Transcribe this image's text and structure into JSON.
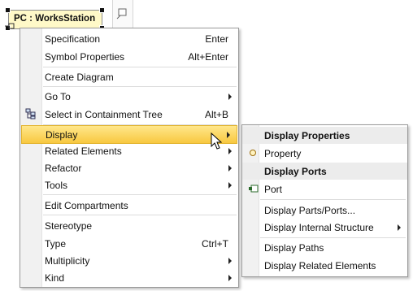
{
  "diagram": {
    "element_label": "PC : WorksStation"
  },
  "context_menu": {
    "items": [
      {
        "label": "Specification",
        "accel": "Enter"
      },
      {
        "label": "Symbol Properties",
        "accel": "Alt+Enter"
      },
      {
        "label": "Create Diagram"
      },
      {
        "label": "Go To"
      },
      {
        "label": "Select in Containment Tree",
        "accel": "Alt+B"
      },
      {
        "label": "Display"
      },
      {
        "label": "Related Elements"
      },
      {
        "label": "Refactor"
      },
      {
        "label": "Tools"
      },
      {
        "label": "Edit Compartments"
      },
      {
        "label": "Stereotype"
      },
      {
        "label": "Type",
        "accel": "Ctrl+T"
      },
      {
        "label": "Multiplicity"
      },
      {
        "label": "Kind"
      }
    ]
  },
  "display_submenu": {
    "items": [
      {
        "label": "Display Properties"
      },
      {
        "label": "Property"
      },
      {
        "label": "Display Ports"
      },
      {
        "label": "Port"
      },
      {
        "label": "Display Parts/Ports..."
      },
      {
        "label": "Display Internal Structure"
      },
      {
        "label": "Display Paths"
      },
      {
        "label": "Display Related Elements"
      }
    ]
  },
  "colors": {
    "highlight_top": "#ffe78b",
    "highlight_bottom": "#f8c840",
    "node_fill": "#fff9c8"
  }
}
